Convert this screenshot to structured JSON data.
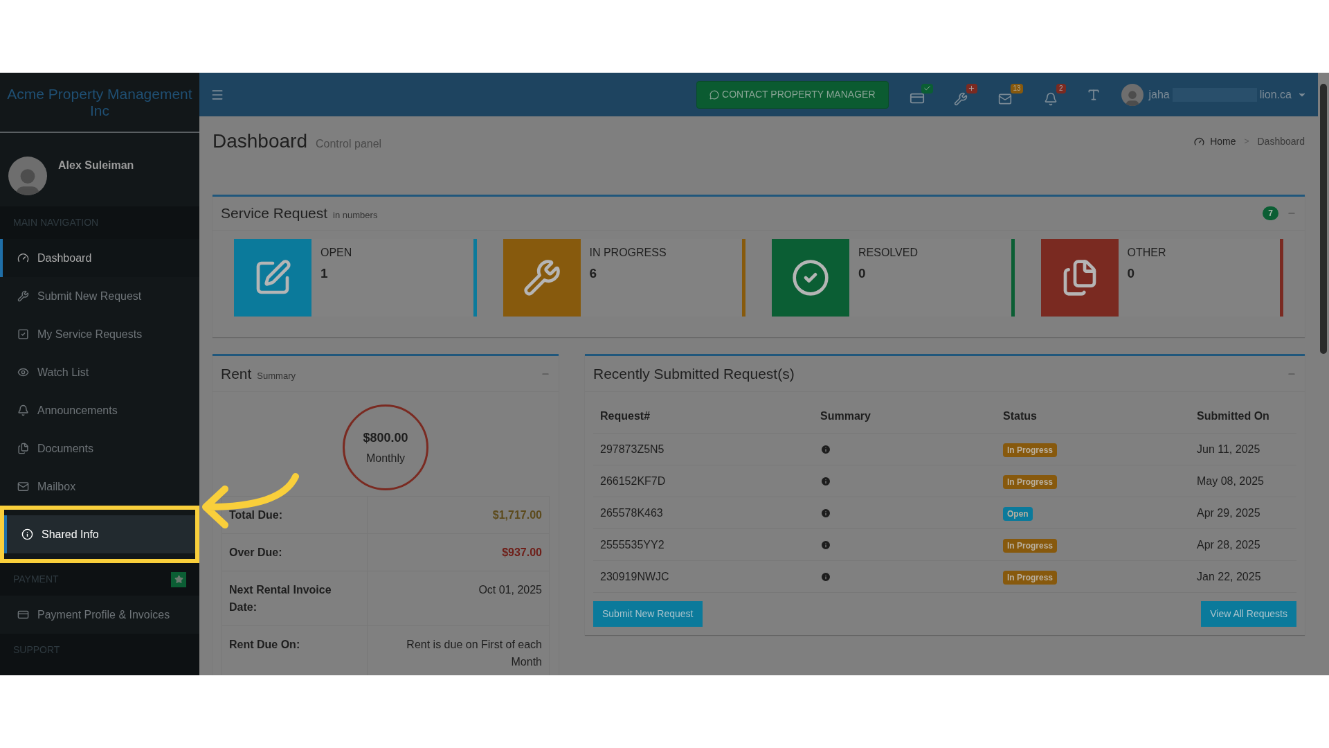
{
  "brand": "Acme Property Management Inc",
  "user": {
    "name": "Alex Suleiman"
  },
  "sidebar": {
    "items": [
      {
        "kind": "header",
        "label": "MAIN NAVIGATION"
      },
      {
        "kind": "link",
        "label": "Dashboard",
        "selected": true,
        "spotlight": false
      },
      {
        "kind": "link",
        "label": "Submit New Request",
        "selected": false,
        "spotlight": false
      },
      {
        "kind": "link",
        "label": "My Service Requests",
        "selected": false,
        "spotlight": false
      },
      {
        "kind": "link",
        "label": "Watch List",
        "selected": false,
        "spotlight": false
      },
      {
        "kind": "link",
        "label": "Announcements",
        "selected": false,
        "spotlight": false
      },
      {
        "kind": "link",
        "label": "Documents",
        "selected": false,
        "spotlight": false
      },
      {
        "kind": "link",
        "label": "Mailbox",
        "selected": false,
        "spotlight": false
      },
      {
        "kind": "link",
        "label": "Shared Info",
        "selected": true,
        "spotlight": true
      },
      {
        "kind": "header",
        "label": "PAYMENT",
        "star": true
      },
      {
        "kind": "link",
        "label": "Payment Profile & Invoices",
        "selected": false,
        "spotlight": false
      },
      {
        "kind": "header",
        "label": "SUPPORT"
      }
    ]
  },
  "topbar": {
    "contact_button": "CONTACT PROPERTY MANAGER",
    "mail_badge": "13",
    "bell_badge": "2",
    "email_start": "jaha",
    "email_end": "lion.ca"
  },
  "page": {
    "title": "Dashboard",
    "subtitle": "Control panel",
    "breadcrumb": [
      "Home",
      "Dashboard"
    ],
    "breadcrumb_separator": ">"
  },
  "service_request": {
    "title": "Service Request",
    "subtitle": "in numbers",
    "badge": "7",
    "stats": [
      {
        "label": "OPEN",
        "value": "1",
        "color": "#0b7a9b"
      },
      {
        "label": "IN PROGRESS",
        "value": "6",
        "color": "#875a0d"
      },
      {
        "label": "RESOLVED",
        "value": "0",
        "color": "#0b5e34"
      },
      {
        "label": "OTHER",
        "value": "0",
        "color": "#7a2a21"
      }
    ]
  },
  "rent": {
    "title": "Rent",
    "subtitle": "Summary",
    "amount": "$800.00",
    "period": "Monthly",
    "rows": [
      {
        "label": "Total Due:",
        "value": "$1,717.00",
        "kind": "due"
      },
      {
        "label": "Over Due:",
        "value": "$937.00",
        "kind": "overdue"
      },
      {
        "label": "Next Rental Invoice Date:",
        "value": "Oct 01, 2025",
        "kind": "plain"
      },
      {
        "label": "Rent Due On:",
        "value": "Rent is due on First of each Month",
        "kind": "text"
      }
    ]
  },
  "recent": {
    "title": "Recently Submitted Request(s)",
    "columns": [
      "Request#",
      "Summary",
      "Status",
      "Submitted On"
    ],
    "rows": [
      {
        "id": "297873Z5N5",
        "status": "In Progress",
        "kind": "progress",
        "date": "Jun 11, 2025"
      },
      {
        "id": "266152KF7D",
        "status": "In Progress",
        "kind": "progress",
        "date": "May 08, 2025"
      },
      {
        "id": "265578K463",
        "status": "Open",
        "kind": "open",
        "date": "Apr 29, 2025"
      },
      {
        "id": "2555535YY2",
        "status": "In Progress",
        "kind": "progress",
        "date": "Apr 28, 2025"
      },
      {
        "id": "230919NWJC",
        "status": "In Progress",
        "kind": "progress",
        "date": "Jan 22, 2025"
      }
    ],
    "buttons": [
      "Submit New Request",
      "View All Requests"
    ]
  }
}
